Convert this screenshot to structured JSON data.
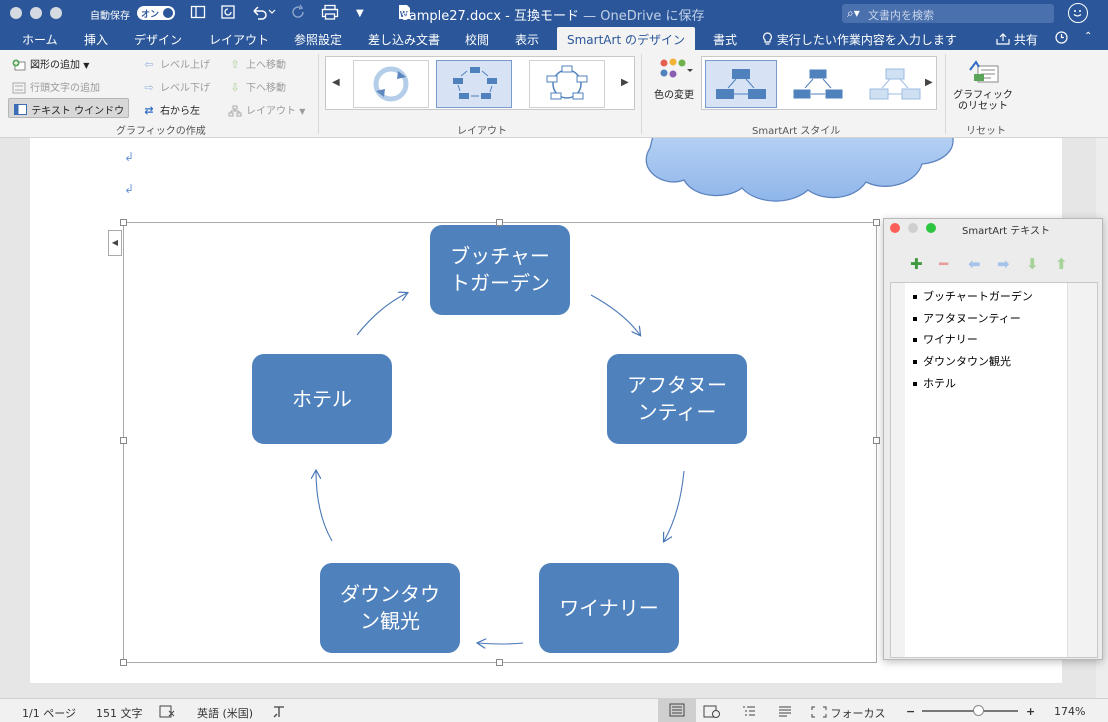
{
  "titlebar": {
    "autosave_label": "自動保存",
    "autosave_state": "オン",
    "doc_name": "sample27.docx",
    "separator": " - ",
    "mode": "互換モード",
    "save_location": "— OneDrive に保存",
    "search_placeholder": "文書内を検索"
  },
  "tabs": {
    "home": "ホーム",
    "insert": "挿入",
    "design": "デザイン",
    "layout": "レイアウト",
    "references": "参照設定",
    "mailings": "差し込み文書",
    "review": "校閲",
    "view": "表示",
    "smartart_design": "SmartArt のデザイン",
    "format": "書式",
    "tell_me": "実行したい作業内容を入力します",
    "share": "共有"
  },
  "ribbon": {
    "create_graphic": {
      "add_shape": "図形の追加",
      "add_bullet": "行頭文字の追加",
      "text_pane": "テキスト ウインドウ",
      "promote": "レベル上げ",
      "demote": "レベル下げ",
      "right_to_left": "右から左",
      "move_up": "上へ移動",
      "move_down": "下へ移動",
      "layout": "レイアウト",
      "group_label": "グラフィックの作成"
    },
    "layouts": {
      "group_label": "レイアウト"
    },
    "styles": {
      "change_colors": "色の変更",
      "group_label": "SmartArt スタイル"
    },
    "reset": {
      "reset_graphic_line1": "グラフィック",
      "reset_graphic_line2": "のリセット",
      "group_label": "リセット"
    }
  },
  "smartart": {
    "nodes": [
      "ブッチャー トガーデン",
      "アフタヌー ンティー",
      "ワイナリー",
      "ダウンタウ ン観光",
      "ホテル"
    ],
    "node_lines": [
      [
        "ブッチャー",
        "トガーデン"
      ],
      [
        "アフタヌー",
        "ンティー"
      ],
      [
        "ワイナリー"
      ],
      [
        "ダウンタウ",
        "ン観光"
      ],
      [
        "ホテル"
      ]
    ]
  },
  "text_pane": {
    "title": "SmartArt テキスト",
    "items": [
      "ブッチャートガーデン",
      "アフタヌーンティー",
      "ワイナリー",
      "ダウンタウン観光",
      "ホテル"
    ]
  },
  "status": {
    "page": "1/1 ページ",
    "words": "151 文字",
    "language": "英語 (米国)",
    "focus": "フォーカス",
    "zoom": "174%"
  },
  "colors": {
    "word_blue": "#2b579a",
    "node_fill": "#4f81bd",
    "arrow": "#4a78b8"
  }
}
